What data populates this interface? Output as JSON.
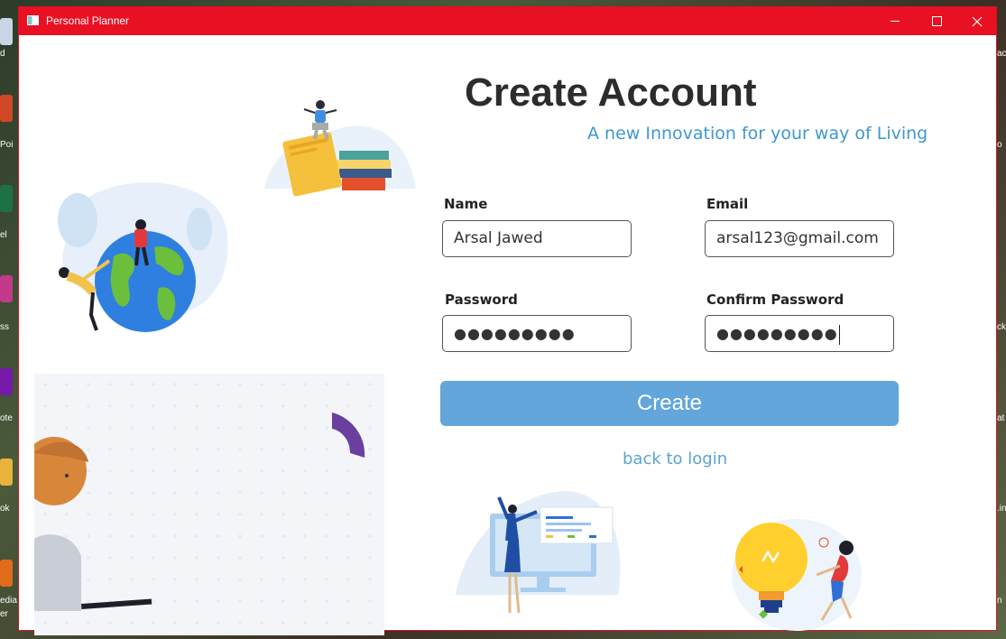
{
  "window": {
    "title": "Personal Planner",
    "controls": {
      "minimize": "minimize",
      "maximize": "maximize",
      "close": "close"
    }
  },
  "desktop": {
    "left_labels": [
      "d",
      "Poi",
      "el",
      "ss",
      "ote",
      "ok",
      "edia",
      "er"
    ],
    "right_labels": [
      "ac",
      "o",
      "ck",
      "at",
      ".in",
      "n"
    ]
  },
  "form": {
    "heading": "Create Account",
    "subheading": "A new Innovation for your way of Living",
    "name_label": "Name",
    "name_value": "Arsal Jawed",
    "email_label": "Email",
    "email_value": "arsal123@gmail.com",
    "password_label": "Password",
    "password_value": "●●●●●●●●●",
    "confirm_label": "Confirm Password",
    "confirm_value": "●●●●●●●●●",
    "create_button": "Create",
    "back_link": "back to login"
  },
  "colors": {
    "titlebar": "#e81123",
    "accent": "#62a6db",
    "subheading": "#3f97d1",
    "heading": "#2c2c2c"
  },
  "icons": [
    "app-icon",
    "minimize-icon",
    "maximize-icon",
    "close-icon"
  ]
}
